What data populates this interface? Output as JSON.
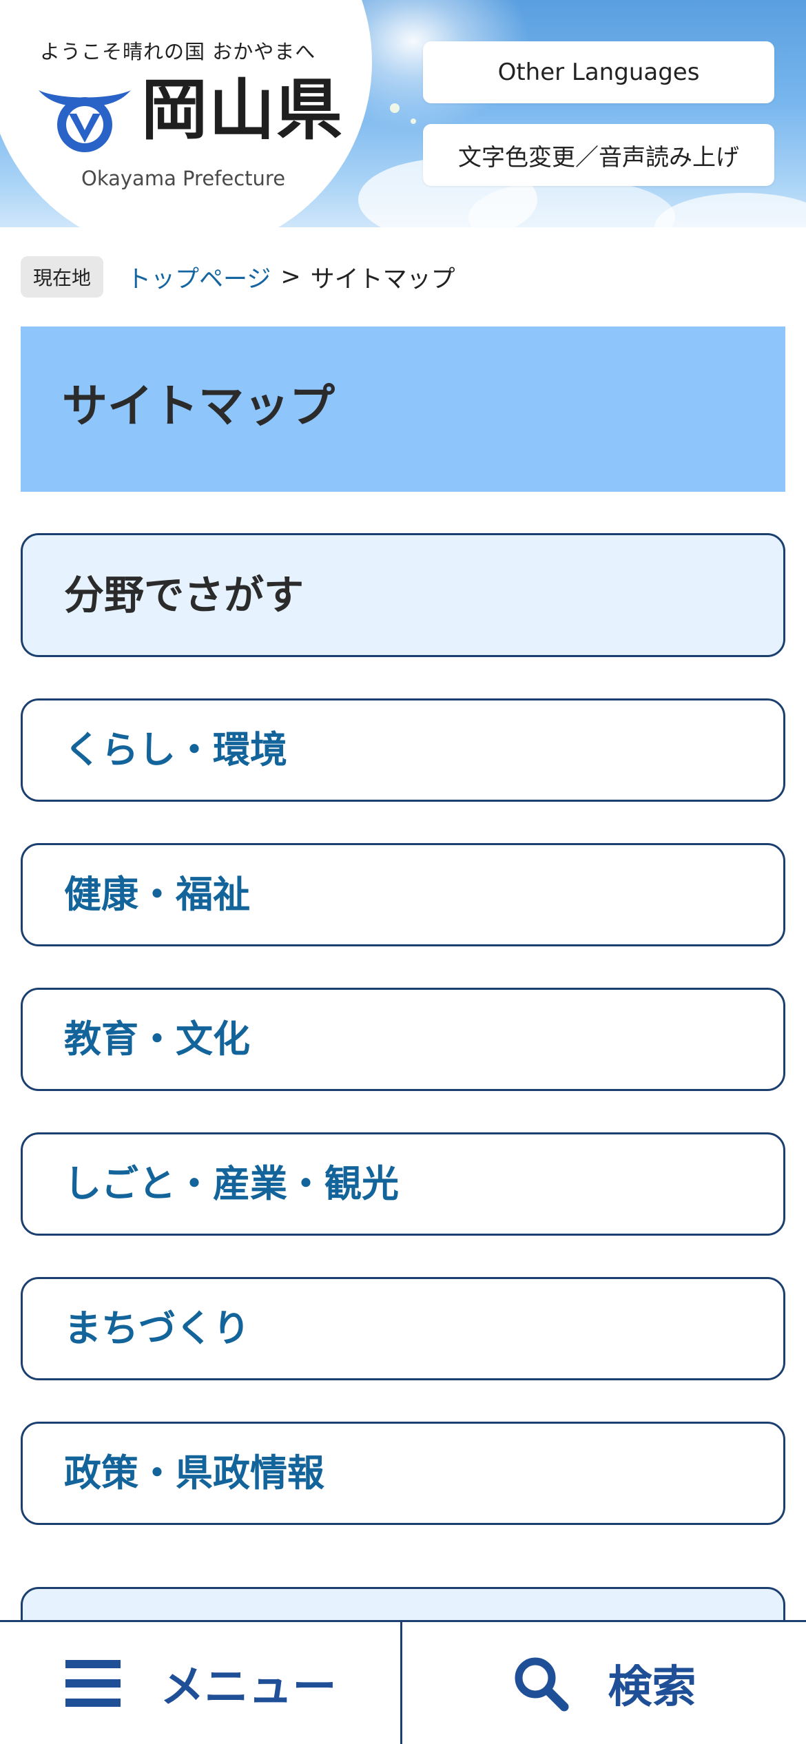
{
  "header": {
    "logo": {
      "tagline": "ようこそ晴れの国 おかやまへ",
      "name": "岡山県",
      "name_en": "Okayama Prefecture",
      "brand_color": "#2a63c7"
    },
    "buttons": {
      "other_languages": "Other Languages",
      "accessibility": "文字色変更／音声読み上げ"
    }
  },
  "breadcrumb": {
    "here_label": "現在地",
    "home_link": "トップページ",
    "separator": ">",
    "current": "サイトマップ"
  },
  "page": {
    "title": "サイトマップ"
  },
  "sitemap": {
    "section_title": "分野でさがす",
    "categories": [
      "くらし・環境",
      "健康・福祉",
      "教育・文化",
      "しごと・産業・観光",
      "まちづくり",
      "政策・県政情報"
    ]
  },
  "bottom_bar": {
    "menu_label": "メニュー",
    "menu_icon": "hamburger-icon",
    "search_label": "検索",
    "search_icon": "search-icon",
    "accent_color": "#1f4f96"
  },
  "colors": {
    "title_band": "#8ec5fa",
    "card_border": "#1b3f6e",
    "link": "#13649a"
  }
}
